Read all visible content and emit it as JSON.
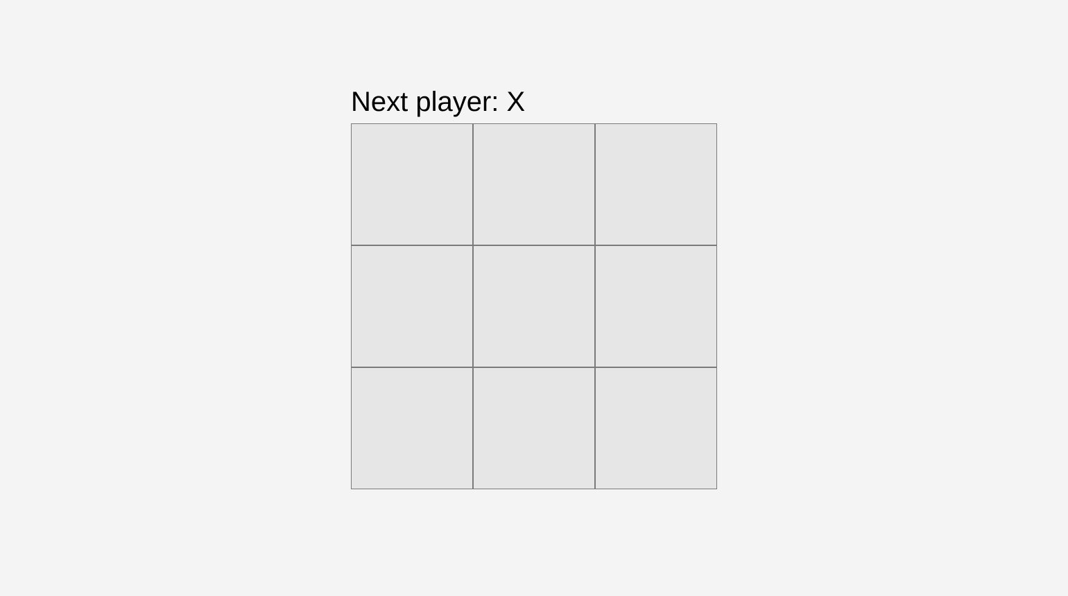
{
  "status": "Next player: X",
  "board": {
    "cells": [
      "",
      "",
      "",
      "",
      "",
      "",
      "",
      "",
      ""
    ]
  }
}
